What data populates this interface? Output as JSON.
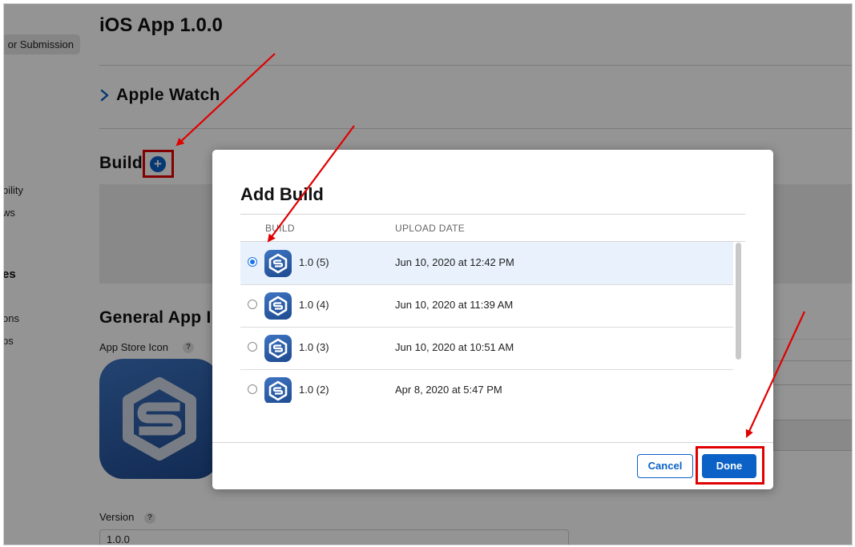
{
  "sidebar": {
    "submission_button": "or Submission",
    "items": [
      "bility",
      "ws",
      "es",
      "ons",
      "ps"
    ]
  },
  "page": {
    "version_title": "iOS App 1.0.0",
    "apple_watch": "Apple Watch",
    "build_section": "Build",
    "build_add": "+",
    "general_info": "General App I",
    "app_store_icon_label": "App Store Icon",
    "version_label": "Version",
    "version_value": "1.0.0",
    "help_glyph": "?"
  },
  "modal": {
    "title": "Add Build",
    "columns": {
      "build": "BUILD",
      "upload_date": "UPLOAD DATE"
    },
    "rows": [
      {
        "build": "1.0 (5)",
        "date": "Jun 10, 2020 at 12:42 PM",
        "selected": true
      },
      {
        "build": "1.0 (4)",
        "date": "Jun 10, 2020 at 11:39 AM",
        "selected": false
      },
      {
        "build": "1.0 (3)",
        "date": "Jun 10, 2020 at 10:51 AM",
        "selected": false
      },
      {
        "build": "1.0 (2)",
        "date": "Apr 8, 2020 at 5:47 PM",
        "selected": false
      }
    ],
    "cancel_label": "Cancel",
    "done_label": "Done"
  },
  "colors": {
    "accent": "#0b61c6",
    "annotation_red": "#e00000",
    "icon_blue": "#2f5ea8"
  },
  "icons": {
    "expand": "chevron-right-icon",
    "add": "plus-circle-icon",
    "app": "app-s-logo-icon"
  }
}
